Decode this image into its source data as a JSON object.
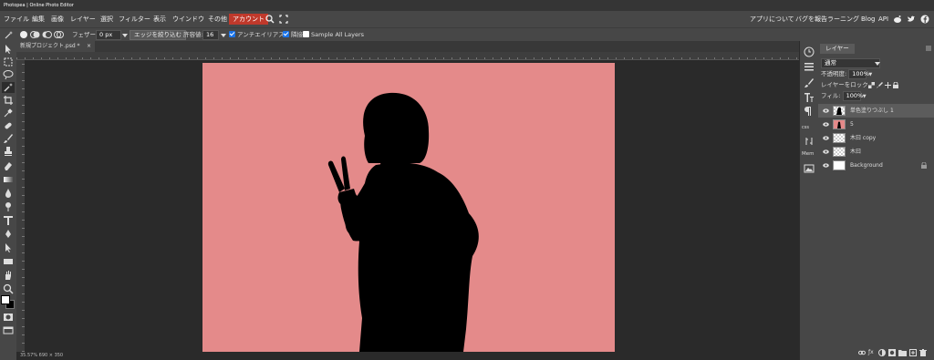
{
  "window": {
    "title": "Photopea | Online Photo Editor"
  },
  "menu": {
    "items": [
      "ファイル",
      "編集",
      "画像",
      "レイヤー",
      "選択",
      "フィルター",
      "表示",
      "ウインドウ",
      "その他"
    ],
    "account": "アカウント",
    "right": [
      "アプリについて",
      "バグを報告",
      "ラーニング",
      "Blog",
      "API"
    ]
  },
  "options": {
    "feather_label": "フェザー:",
    "feather_value": "0 px",
    "refine_edge": "エッジを絞り込む",
    "tolerance_label": "許容値:",
    "tolerance_value": "16",
    "antialias": "アンチエイリアス",
    "contiguous": "隣接",
    "sample_all": "Sample All Layers"
  },
  "document": {
    "tab_name": "新規プロジェクト.psd *",
    "status": "35.57% 690 × 350"
  },
  "collapsed_panel": {
    "css": "css",
    "memory": "Mem"
  },
  "layers_panel": {
    "tab": "レイヤー",
    "blend_mode": "通常",
    "opacity_label": "不透明度:",
    "opacity_value": "100%",
    "lock_label": "レイヤーをロック:",
    "fill_label": "フィル:",
    "fill_value": "100%",
    "layers": [
      {
        "name": "単色塗りつぶし 1",
        "selected": true
      },
      {
        "name": "5",
        "selected": false
      },
      {
        "name": "木曰 copy",
        "selected": false
      },
      {
        "name": "木曰",
        "selected": false
      },
      {
        "name": "Background",
        "selected": false
      }
    ]
  },
  "colors": {
    "canvas": "#e48a8a",
    "account": "#c0392b",
    "selection": "#1a73e8"
  }
}
